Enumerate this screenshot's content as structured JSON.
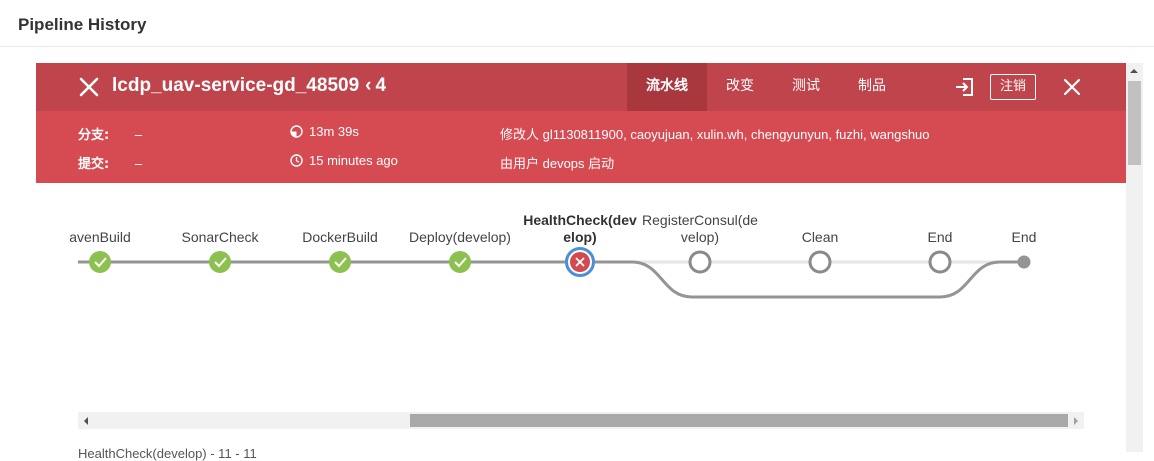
{
  "page": {
    "title": "Pipeline History"
  },
  "run": {
    "name": "lcdp_uav-service-gd_48509",
    "run_number": "4",
    "tabs": [
      {
        "label": "流水线",
        "active": true
      },
      {
        "label": "改变",
        "active": false
      },
      {
        "label": "测试",
        "active": false
      },
      {
        "label": "制品",
        "active": false
      }
    ],
    "logout_label": "注销",
    "branch_label": "分支:",
    "branch_value": "–",
    "commit_label": "提交:",
    "commit_value": "–",
    "duration": "13m 39s",
    "started": "15 minutes ago",
    "changes": "修改人 gl1130811900, caoyujuan, xulin.wh, chengyunyun, fuzhi, wangshuo",
    "trigger": "由用户 devops 启动"
  },
  "colors": {
    "topbar": "#c0444c",
    "infobar": "#d64a52",
    "success": "#8cc04f",
    "failed": "#d24a50",
    "selected_ring": "#4a90d9",
    "pending_stroke": "#8a8a8a"
  },
  "stages": [
    {
      "label": "avenBuild",
      "status": "success"
    },
    {
      "label": "SonarCheck",
      "status": "success"
    },
    {
      "label": "DockerBuild",
      "status": "success"
    },
    {
      "label": "Deploy(develop)",
      "status": "success"
    },
    {
      "label_line1": "HealthCheck(dev",
      "label_line2": "elop)",
      "status": "failed",
      "selected": true
    },
    {
      "label_line1": "RegisterConsul(de",
      "label_line2": "velop)",
      "status": "not-run"
    },
    {
      "label": "Clean",
      "status": "not-run"
    },
    {
      "label": "End",
      "status": "not-run"
    },
    {
      "label": "End",
      "status": "end"
    }
  ],
  "bottom_peek": "HealthCheck(develop) - 11 - 11"
}
